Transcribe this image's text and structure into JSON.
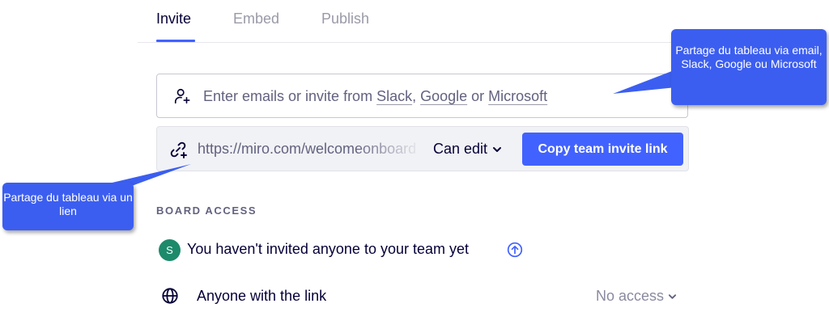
{
  "tabs": [
    {
      "label": "Invite",
      "active": true
    },
    {
      "label": "Embed",
      "active": false
    },
    {
      "label": "Publish",
      "active": false
    }
  ],
  "invite": {
    "prefix": "Enter emails or invite from ",
    "link_slack": "Slack",
    "sep1": ", ",
    "link_google": "Google",
    "sep2": " or ",
    "link_microsoft": "Microsoft",
    "icon": "add-user-icon"
  },
  "share_link": {
    "url": "https://miro.com/welcomeonboard",
    "permission": "Can edit",
    "copy_button": "Copy team invite link",
    "icon": "link-icon"
  },
  "board_access": {
    "section_label": "BOARD ACCESS",
    "avatar_letter": "S",
    "not_invited_text": "You haven't invited anyone to your team yet",
    "anyone_label": "Anyone with the link",
    "anyone_permission": "No access"
  },
  "annotations": {
    "right": "Partage du tableau via email, Slack, Google ou Microsoft",
    "left": "Partage du tableau via un lien"
  },
  "colors": {
    "accent": "#4262ff",
    "callout": "#3c5ef0",
    "avatar": "#1d8a6b",
    "text": "#050038"
  }
}
